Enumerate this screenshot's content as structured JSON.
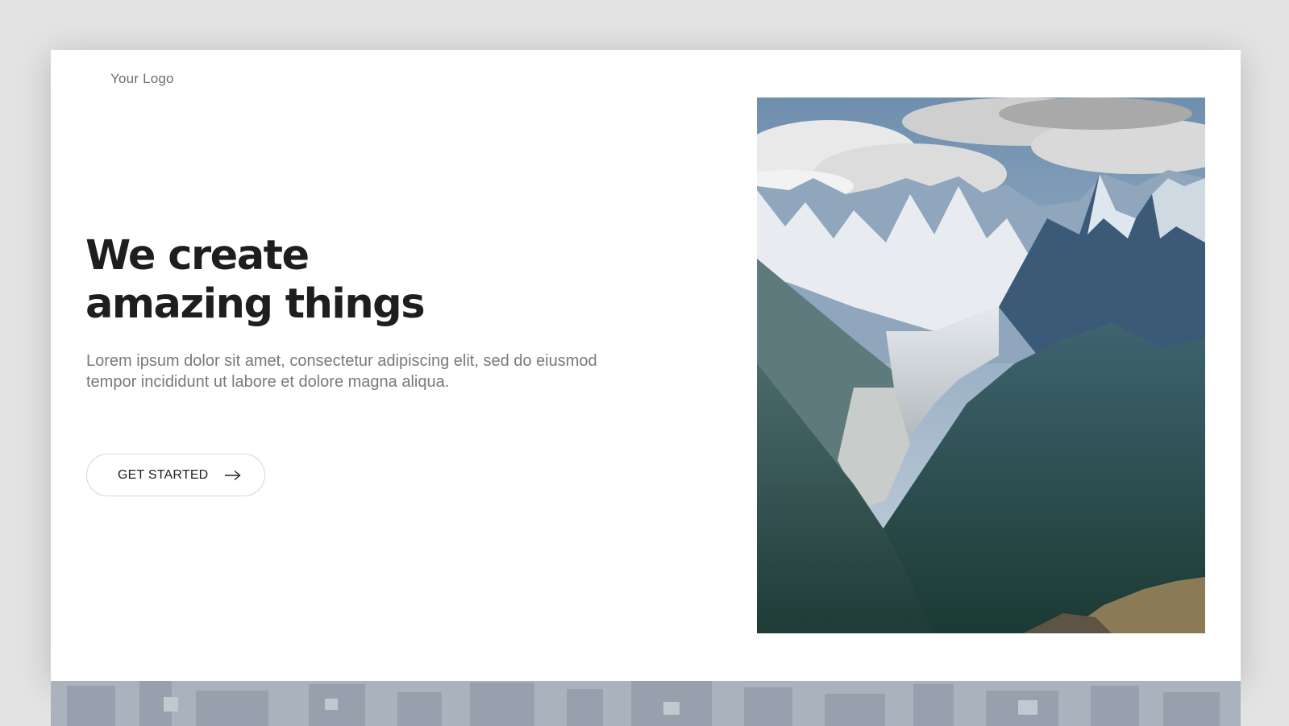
{
  "brand": {
    "logo_text": "Your Logo"
  },
  "hero": {
    "title_line_1": "We create",
    "title_line_2": "amazing things",
    "body": "Lorem ipsum dolor sit amet, consectetur adipiscing elit, sed do eiusmod tempor incididunt ut labore et dolore magna aliqua.",
    "cta_label": "GET STARTED",
    "cta_icon": "arrow-right-icon"
  },
  "media": {
    "photo_subject": "mountain-landscape",
    "strip_subject": "city-aerial"
  },
  "colors": {
    "page_background": "#e3e3e3",
    "card_background": "#ffffff",
    "title": "#1e1e1e",
    "body_text": "#7a7a7a",
    "button_border": "#d6d6d6"
  }
}
